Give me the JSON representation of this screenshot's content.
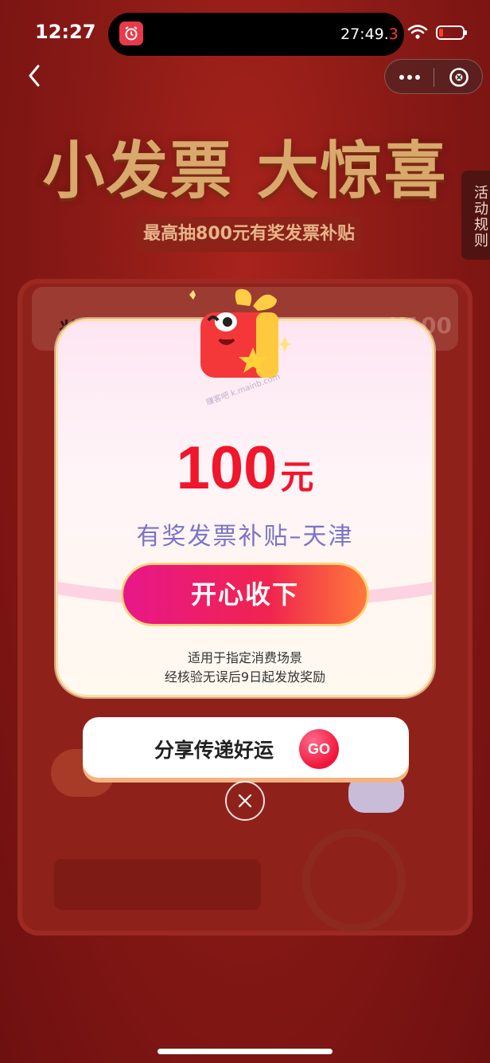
{
  "status_bar": {
    "time": "12:27",
    "timer_main": "27:49.",
    "timer_red": "3",
    "alarm_icon": "alarm-clock-icon",
    "wifi_icon": "wifi-icon",
    "battery_icon": "battery-low-icon"
  },
  "nav": {
    "back_icon": "chevron-left-icon",
    "more_icon": "more-dots-icon",
    "close_icon": "close-circle-icon"
  },
  "background_page": {
    "title": "小发票 大惊喜",
    "subtitle": "最高抽800元有奖发票补贴",
    "prize_label": "奖品",
    "prize_value": "¥100",
    "rules_tab": "活动规则"
  },
  "modal": {
    "amount": "100",
    "unit": "元",
    "subsidy_title": "有奖发票补贴–天津",
    "accept_label": "开心收下",
    "note_line1": "适用于指定消费场景",
    "note_line2": "经核验无误后9日起发放奖励",
    "watermark": "赚客吧 k.mainb.com"
  },
  "share": {
    "label": "分享传递好运",
    "go_label": "GO"
  },
  "colors": {
    "accent_red": "#f0162c",
    "subsidy_purple": "#7b74c6",
    "button_gradient_start": "#e8178a",
    "button_gradient_end": "#ff7a3a",
    "background_red": "#8a1a16"
  }
}
